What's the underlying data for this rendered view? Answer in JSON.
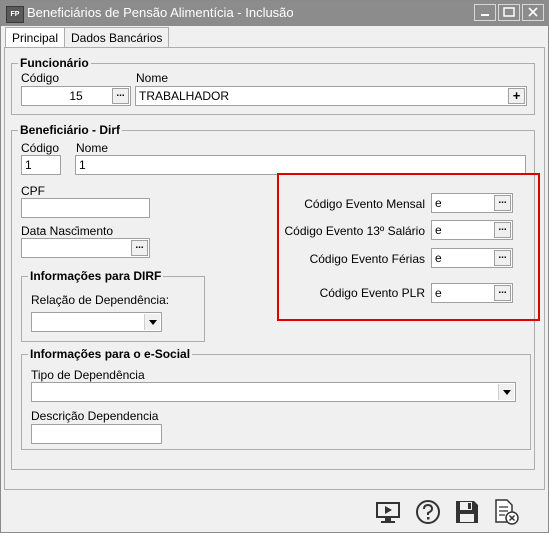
{
  "window": {
    "title": "Beneficiários de Pensão Alimentícia - Inclusão",
    "icon_text": "FP"
  },
  "tabs": [
    {
      "label": "Principal"
    },
    {
      "label": "Dados Bancários"
    }
  ],
  "funcionario": {
    "title": "Funcionário",
    "codigo_label": "Código",
    "codigo_value": "15",
    "nome_label": "Nome",
    "nome_value": "TRABALHADOR"
  },
  "beneficiario": {
    "title": "Beneficiário - Dirf",
    "codigo_label": "Código",
    "codigo_value": "1",
    "nome_label": "Nome",
    "nome_value": "1",
    "cpf_label": "CPF",
    "cpf_value": " .    .    -",
    "nascimento_label": "Data Nascimento",
    "nascimento_value": ""
  },
  "eventos": {
    "mensal_label": "Código Evento Mensal",
    "mensal_value": "e",
    "salario13_label": "Código Evento 13º Salário",
    "salario13_value": "e",
    "ferias_label": "Código Evento Férias",
    "ferias_value": "e",
    "plr_label": "Código Evento PLR",
    "plr_value": "e",
    "highlight_color": "#e00000"
  },
  "dirf": {
    "title": "Informações para DIRF",
    "relacao_label": "Relação de Dependência:",
    "relacao_value": ""
  },
  "esocial": {
    "title": "Informações para o e-Social",
    "tipo_label": "Tipo de Dependência",
    "tipo_value": "",
    "descricao_label": "Descrição Dependencia",
    "descricao_value": ""
  },
  "ellipsis": "...",
  "plus": "+",
  "toolbar": [
    "presentation-icon",
    "help-icon",
    "save-icon",
    "cancel-document-icon"
  ]
}
